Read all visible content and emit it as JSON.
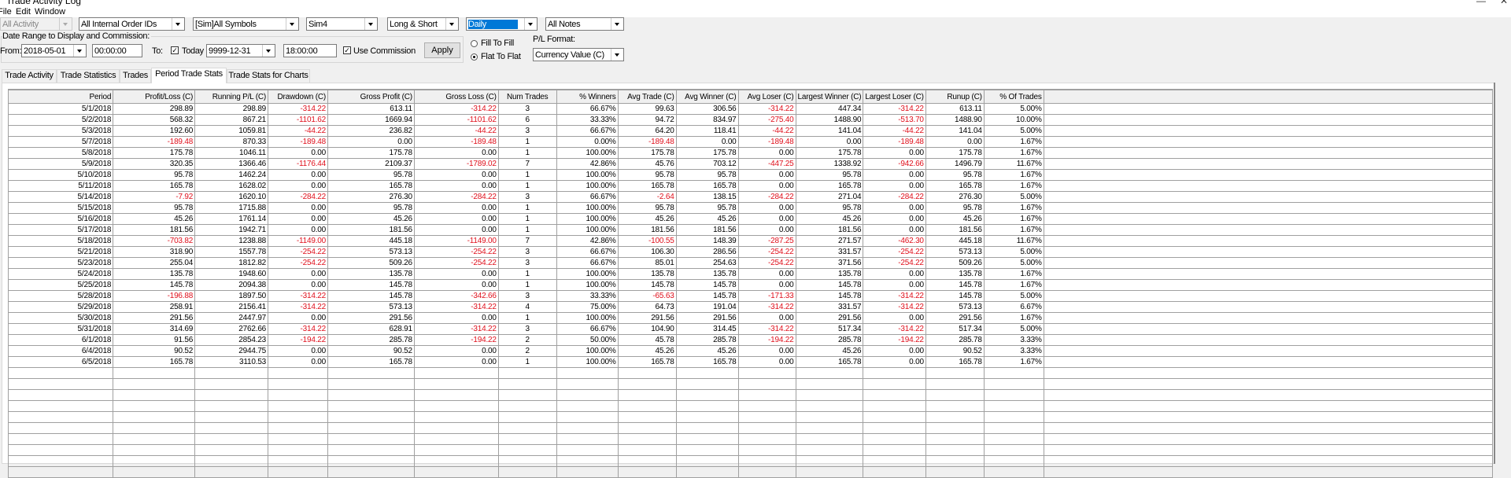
{
  "window": {
    "title": "Trade Activity Log",
    "minimize_icon": "minimize-icon",
    "close_icon": "close-icon"
  },
  "menu": [
    "File",
    "Edit",
    "Window"
  ],
  "filters": {
    "activity": "All Activity",
    "order_ids": "All Internal Order IDs",
    "symbols": "[Sim]All Symbols",
    "account": "Sim4",
    "direction": "Long & Short",
    "period": "Daily",
    "notes": "All Notes"
  },
  "date_range": {
    "group_label": "Date Range to Display and Commission:",
    "from_label": "From:",
    "from_date": "2018-05-01",
    "from_time": "00:00:00",
    "to_label": "To:",
    "today_checked": true,
    "today_label": "Today",
    "to_date": "9999-12-31",
    "to_time": "18:00:00",
    "use_commission_checked": true,
    "use_commission_label": "Use Commission",
    "apply_label": "Apply"
  },
  "fill_mode": {
    "options": [
      "Fill To Fill",
      "Flat To Flat"
    ],
    "selected": "Flat To Flat"
  },
  "pl_format": {
    "label": "P/L Format:",
    "value": "Currency Value (C)"
  },
  "tabs": [
    "Trade Activity",
    "Trade Statistics",
    "Trades",
    "Period Trade Stats",
    "Trade Stats for Charts"
  ],
  "active_tab": "Period Trade Stats",
  "colors": {
    "negative": "#e0101c",
    "selection": "#0078d7"
  },
  "table": {
    "columns": [
      "Period",
      "Profit/Loss (C)",
      "Running P/L (C)",
      "Drawdown (C)",
      "Gross Profit (C)",
      "Gross Loss (C)",
      "Num Trades",
      "% Winners",
      "Avg Trade (C)",
      "Avg Winner (C)",
      "Avg Loser (C)",
      "Largest Winner (C)",
      "Largest Loser (C)",
      "Runup (C)",
      "% Of Trades"
    ],
    "rows": [
      [
        "5/1/2018",
        "298.89",
        "298.89",
        "-314.22",
        "613.11",
        "-314.22",
        "3",
        "66.67%",
        "99.63",
        "306.56",
        "-314.22",
        "447.34",
        "-314.22",
        "613.11",
        "5.00%"
      ],
      [
        "5/2/2018",
        "568.32",
        "867.21",
        "-1101.62",
        "1669.94",
        "-1101.62",
        "6",
        "33.33%",
        "94.72",
        "834.97",
        "-275.40",
        "1488.90",
        "-513.70",
        "1488.90",
        "10.00%"
      ],
      [
        "5/3/2018",
        "192.60",
        "1059.81",
        "-44.22",
        "236.82",
        "-44.22",
        "3",
        "66.67%",
        "64.20",
        "118.41",
        "-44.22",
        "141.04",
        "-44.22",
        "141.04",
        "5.00%"
      ],
      [
        "5/7/2018",
        "-189.48",
        "870.33",
        "-189.48",
        "0.00",
        "-189.48",
        "1",
        "0.00%",
        "-189.48",
        "0.00",
        "-189.48",
        "0.00",
        "-189.48",
        "0.00",
        "1.67%"
      ],
      [
        "5/8/2018",
        "175.78",
        "1046.11",
        "0.00",
        "175.78",
        "0.00",
        "1",
        "100.00%",
        "175.78",
        "175.78",
        "0.00",
        "175.78",
        "0.00",
        "175.78",
        "1.67%"
      ],
      [
        "5/9/2018",
        "320.35",
        "1366.46",
        "-1176.44",
        "2109.37",
        "-1789.02",
        "7",
        "42.86%",
        "45.76",
        "703.12",
        "-447.25",
        "1338.92",
        "-942.66",
        "1496.79",
        "11.67%"
      ],
      [
        "5/10/2018",
        "95.78",
        "1462.24",
        "0.00",
        "95.78",
        "0.00",
        "1",
        "100.00%",
        "95.78",
        "95.78",
        "0.00",
        "95.78",
        "0.00",
        "95.78",
        "1.67%"
      ],
      [
        "5/11/2018",
        "165.78",
        "1628.02",
        "0.00",
        "165.78",
        "0.00",
        "1",
        "100.00%",
        "165.78",
        "165.78",
        "0.00",
        "165.78",
        "0.00",
        "165.78",
        "1.67%"
      ],
      [
        "5/14/2018",
        "-7.92",
        "1620.10",
        "-284.22",
        "276.30",
        "-284.22",
        "3",
        "66.67%",
        "-2.64",
        "138.15",
        "-284.22",
        "271.04",
        "-284.22",
        "276.30",
        "5.00%"
      ],
      [
        "5/15/2018",
        "95.78",
        "1715.88",
        "0.00",
        "95.78",
        "0.00",
        "1",
        "100.00%",
        "95.78",
        "95.78",
        "0.00",
        "95.78",
        "0.00",
        "95.78",
        "1.67%"
      ],
      [
        "5/16/2018",
        "45.26",
        "1761.14",
        "0.00",
        "45.26",
        "0.00",
        "1",
        "100.00%",
        "45.26",
        "45.26",
        "0.00",
        "45.26",
        "0.00",
        "45.26",
        "1.67%"
      ],
      [
        "5/17/2018",
        "181.56",
        "1942.71",
        "0.00",
        "181.56",
        "0.00",
        "1",
        "100.00%",
        "181.56",
        "181.56",
        "0.00",
        "181.56",
        "0.00",
        "181.56",
        "1.67%"
      ],
      [
        "5/18/2018",
        "-703.82",
        "1238.88",
        "-1149.00",
        "445.18",
        "-1149.00",
        "7",
        "42.86%",
        "-100.55",
        "148.39",
        "-287.25",
        "271.57",
        "-462.30",
        "445.18",
        "11.67%"
      ],
      [
        "5/21/2018",
        "318.90",
        "1557.78",
        "-254.22",
        "573.13",
        "-254.22",
        "3",
        "66.67%",
        "106.30",
        "286.56",
        "-254.22",
        "331.57",
        "-254.22",
        "573.13",
        "5.00%"
      ],
      [
        "5/23/2018",
        "255.04",
        "1812.82",
        "-254.22",
        "509.26",
        "-254.22",
        "3",
        "66.67%",
        "85.01",
        "254.63",
        "-254.22",
        "371.56",
        "-254.22",
        "509.26",
        "5.00%"
      ],
      [
        "5/24/2018",
        "135.78",
        "1948.60",
        "0.00",
        "135.78",
        "0.00",
        "1",
        "100.00%",
        "135.78",
        "135.78",
        "0.00",
        "135.78",
        "0.00",
        "135.78",
        "1.67%"
      ],
      [
        "5/25/2018",
        "145.78",
        "2094.38",
        "0.00",
        "145.78",
        "0.00",
        "1",
        "100.00%",
        "145.78",
        "145.78",
        "0.00",
        "145.78",
        "0.00",
        "145.78",
        "1.67%"
      ],
      [
        "5/28/2018",
        "-196.88",
        "1897.50",
        "-314.22",
        "145.78",
        "-342.66",
        "3",
        "33.33%",
        "-65.63",
        "145.78",
        "-171.33",
        "145.78",
        "-314.22",
        "145.78",
        "5.00%"
      ],
      [
        "5/29/2018",
        "258.91",
        "2156.41",
        "-314.22",
        "573.13",
        "-314.22",
        "4",
        "75.00%",
        "64.73",
        "191.04",
        "-314.22",
        "331.57",
        "-314.22",
        "573.13",
        "6.67%"
      ],
      [
        "5/30/2018",
        "291.56",
        "2447.97",
        "0.00",
        "291.56",
        "0.00",
        "1",
        "100.00%",
        "291.56",
        "291.56",
        "0.00",
        "291.56",
        "0.00",
        "291.56",
        "1.67%"
      ],
      [
        "5/31/2018",
        "314.69",
        "2762.66",
        "-314.22",
        "628.91",
        "-314.22",
        "3",
        "66.67%",
        "104.90",
        "314.45",
        "-314.22",
        "517.34",
        "-314.22",
        "517.34",
        "5.00%"
      ],
      [
        "6/1/2018",
        "91.56",
        "2854.23",
        "-194.22",
        "285.78",
        "-194.22",
        "2",
        "50.00%",
        "45.78",
        "285.78",
        "-194.22",
        "285.78",
        "-194.22",
        "285.78",
        "3.33%"
      ],
      [
        "6/4/2018",
        "90.52",
        "2944.75",
        "0.00",
        "90.52",
        "0.00",
        "2",
        "100.00%",
        "45.26",
        "45.26",
        "0.00",
        "45.26",
        "0.00",
        "90.52",
        "3.33%"
      ],
      [
        "6/5/2018",
        "165.78",
        "3110.53",
        "0.00",
        "165.78",
        "0.00",
        "1",
        "100.00%",
        "165.78",
        "165.78",
        "0.00",
        "165.78",
        "0.00",
        "165.78",
        "1.67%"
      ]
    ]
  }
}
